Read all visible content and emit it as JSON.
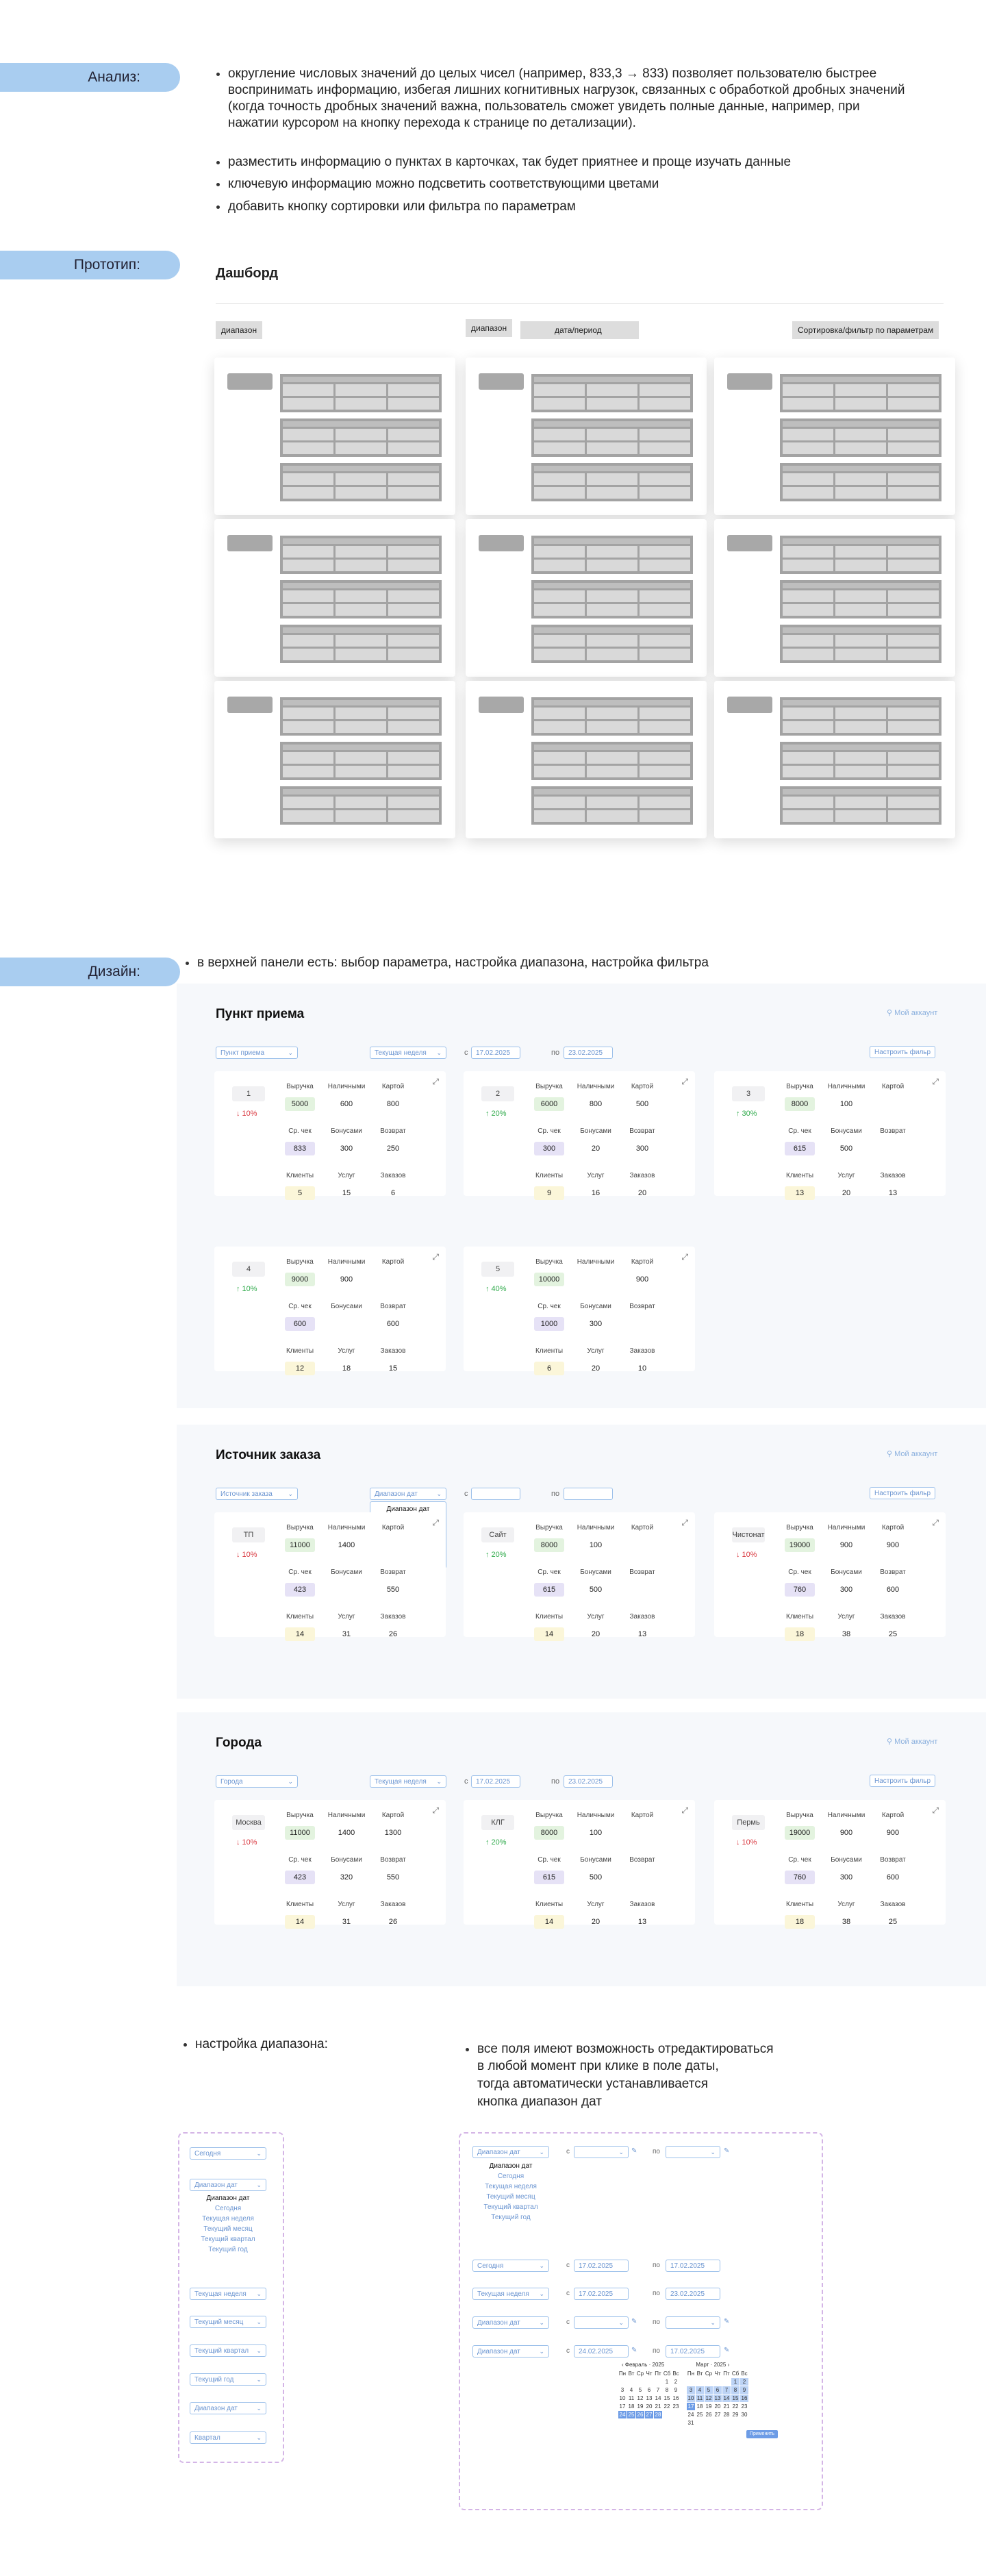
{
  "analysis": {
    "tag": "Анализ:",
    "points": [
      "округление числовых значений до целых чисел (например, 833,3 → 833) позволяет пользователю быстрее воспринимать информацию, избегая лишних когнитивных нагрузок, связанных с обработкой дробных значений (когда точность дробных значений важна, пользователь сможет увидеть полные данные, например, при нажатии курсором на кнопку перехода к странице по детализации).",
      "разместить информацию о пунктах в карточках, так будет приятнее и проще изучать данные",
      "ключевую информацию можно подсветить соответствующими цветами",
      "добавить кнопку сортировки или фильтра по параметрам"
    ]
  },
  "prototype": {
    "tag": "Прототип:",
    "title": "Дашборд",
    "btn_range": "диапазон",
    "btn_range2": "диапазон",
    "btn_date": "дата/период",
    "btn_sort": "Сортировка/фильтр по параметрам"
  },
  "design": {
    "tag": "Дизайн:",
    "intro": "в верхней панели есть:  выбор параметра, настройка диапазона, настройка фильтра"
  },
  "labels": {
    "revenue": "Выручка",
    "cash": "Наличными",
    "card": "Картой",
    "avg": "Ср. чек",
    "bonus": "Бонусами",
    "refund": "Возврат",
    "clients": "Клиенты",
    "services": "Услуг",
    "orders": "Заказов",
    "account": "Мой аккаунт",
    "from": "с",
    "to": "по",
    "filter": "Настроить фильр",
    "expand": "⤢"
  },
  "colors": {
    "green": "#e3f3df",
    "purple": "#e6e2f6",
    "yellow": "#fbf6d9",
    "up": "#2eaa4a",
    "down": "#d9363e"
  },
  "panels": [
    {
      "title": "Пункт приема",
      "select": "Пункт приема",
      "range": "Текущая неделя",
      "from": "17.02.2025",
      "to": "23.02.2025",
      "cards": [
        {
          "name": "1",
          "pct": "↓ 10%",
          "dir": "down",
          "v": [
            "5000",
            "600",
            "800",
            "833",
            "300",
            "250",
            "5",
            "15",
            "6"
          ]
        },
        {
          "name": "2",
          "pct": "↑ 20%",
          "dir": "up",
          "v": [
            "6000",
            "800",
            "500",
            "300",
            "20",
            "300",
            "9",
            "16",
            "20"
          ]
        },
        {
          "name": "3",
          "pct": "↑ 30%",
          "dir": "up",
          "v": [
            "8000",
            "100",
            "",
            "615",
            "500",
            "",
            "13",
            "20",
            "13"
          ]
        },
        {
          "name": "4",
          "pct": "↑ 10%",
          "dir": "up",
          "v": [
            "9000",
            "900",
            "",
            "600",
            "",
            "600",
            "12",
            "18",
            "15"
          ]
        },
        {
          "name": "5",
          "pct": "↑ 40%",
          "dir": "up",
          "v": [
            "10000",
            "",
            "900",
            "1000",
            "300",
            "",
            "6",
            "20",
            "10"
          ]
        }
      ]
    },
    {
      "title": "Источник заказа",
      "select": "Источник заказа",
      "range": "Диапазон дат",
      "from": "",
      "to": "",
      "menu": [
        "Диапазон дат",
        "Сегодня",
        "Текущая неделя",
        "Текущий месяц",
        "Текущий квартал",
        "Текущий год"
      ],
      "cards": [
        {
          "name": "ТП",
          "pct": "↓ 10%",
          "dir": "down",
          "v": [
            "11000",
            "1400",
            "",
            "423",
            "",
            "550",
            "14",
            "31",
            "26"
          ]
        },
        {
          "name": "Сайт",
          "pct": "↑ 20%",
          "dir": "up",
          "v": [
            "8000",
            "100",
            "",
            "615",
            "500",
            "",
            "14",
            "20",
            "13"
          ]
        },
        {
          "name": "Чистонат",
          "pct": "↓ 10%",
          "dir": "down",
          "v": [
            "19000",
            "900",
            "900",
            "760",
            "300",
            "600",
            "18",
            "38",
            "25"
          ]
        }
      ]
    },
    {
      "title": "Города",
      "select": "Города",
      "range": "Текущая неделя",
      "from": "17.02.2025",
      "to": "23.02.2025",
      "cards": [
        {
          "name": "Москва",
          "pct": "↓ 10%",
          "dir": "down",
          "v": [
            "11000",
            "1400",
            "1300",
            "423",
            "320",
            "550",
            "14",
            "31",
            "26"
          ]
        },
        {
          "name": "КЛГ",
          "pct": "↑ 20%",
          "dir": "up",
          "v": [
            "8000",
            "100",
            "",
            "615",
            "500",
            "",
            "14",
            "20",
            "13"
          ]
        },
        {
          "name": "Пермь",
          "pct": "↓ 10%",
          "dir": "down",
          "v": [
            "19000",
            "900",
            "900",
            "760",
            "300",
            "600",
            "18",
            "38",
            "25"
          ]
        }
      ]
    }
  ],
  "range_setup": {
    "title": "настройка диапазона:",
    "items": [
      "Сегодня",
      "Диапазон дат",
      "Текущая неделя",
      "Текущий месяц",
      "Текущий квартал",
      "Текущий год",
      "Диапазон дат",
      "Квартал"
    ],
    "menu": [
      "Диапазон дат",
      "Сегодня",
      "Текущая неделя",
      "Текущий месяц",
      "Текущий квартал",
      "Текущий год"
    ]
  },
  "edit_note": {
    "text": [
      "все поля имеют возможность отредактироваться",
      "в любой момент при клике в поле даты,",
      "тогда автоматически устанавливается",
      "кнопка диапазон дат"
    ],
    "rows": [
      {
        "select": "Сегодня",
        "from": "17.02.2025",
        "to": "17.02.2025"
      },
      {
        "select": "Текущая неделя",
        "from": "17.02.2025",
        "to": "23.02.2025"
      },
      {
        "select": "Диапазон дат",
        "from": "",
        "to": ""
      },
      {
        "select": "Диапазон дат",
        "from": "24.02.2025",
        "to": "17.02.2025"
      }
    ],
    "top_select": "Диапазон дат",
    "calendar": {
      "m1": "Февраль",
      "y1": "2025",
      "m2": "Март",
      "y2": "2025",
      "btn": "Применить",
      "days": [
        "Пн",
        "Вт",
        "Ср",
        "Чт",
        "Пт",
        "Сб",
        "Вс"
      ]
    }
  }
}
